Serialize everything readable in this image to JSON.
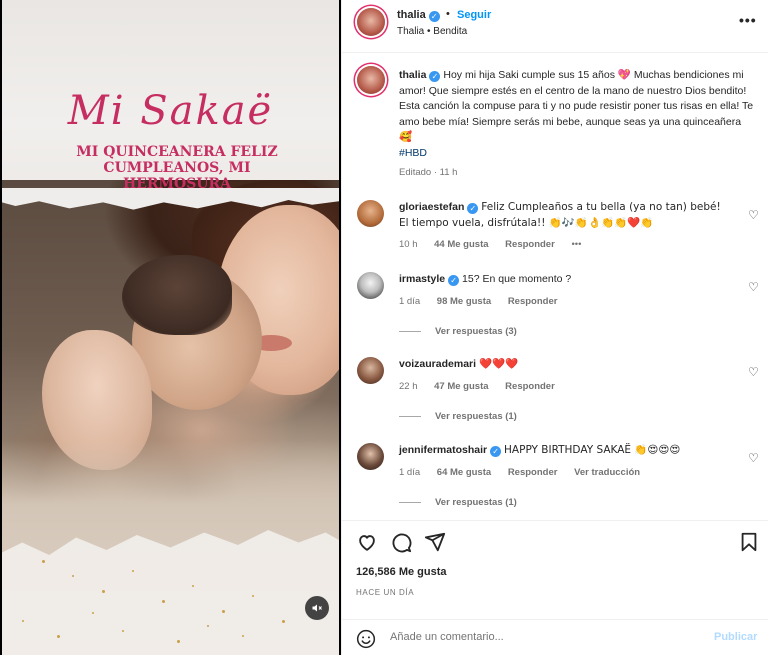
{
  "media": {
    "title": "Mi Sakaë",
    "subtitle": "MI QUINCEANERA FELIZ CUMPLEANOS, MI HERMOSURA",
    "mute_icon": "speaker-muted-icon"
  },
  "header": {
    "username": "thalia",
    "follow_label": "Seguir",
    "subtitle": "Thalia • Bendita",
    "more_icon": "more-horizontal-icon"
  },
  "caption": {
    "username": "thalia",
    "text": "Hoy mi hija Saki cumple sus 15 años 💖 Muchas bendiciones mi amor! Que siempre estés en el centro de la mano de nuestro Dios bendito! Esta canción la compuse para ti y no pude resistir poner tus risas en ella! Te amo bebe mía! Siempre serás mi bebe, aunque seas ya una quinceañera 🥰",
    "hashtag": "#HBD",
    "meta": "Editado · 11 h"
  },
  "comments": [
    {
      "username": "gloriaestefan",
      "verified": true,
      "text": "Feliz Cumpleaños a tu bella (ya no tan) bebé! El tiempo vuela, disfrútala!! 👏🎶👏👌👏👏❤️👏",
      "time": "10 h",
      "likes": "44 Me gusta",
      "reply": "Responder",
      "more": "•••"
    },
    {
      "username": "irmastyle",
      "verified": true,
      "text": "15? En que momento ?",
      "time": "1 día",
      "likes": "98 Me gusta",
      "reply": "Responder",
      "view_replies": "Ver respuestas (3)"
    },
    {
      "username": "voizaurademari",
      "verified": false,
      "text": "❤️❤️❤️",
      "time": "22 h",
      "likes": "47 Me gusta",
      "reply": "Responder",
      "view_replies": "Ver respuestas (1)"
    },
    {
      "username": "jennifermatoshair",
      "verified": true,
      "text": "HAPPY BIRTHDAY SAKAË 👏😍😍😍",
      "time": "1 día",
      "likes": "64 Me gusta",
      "reply": "Responder",
      "translate": "Ver traducción",
      "view_replies": "Ver respuestas (1)"
    }
  ],
  "actions": {
    "like_icon": "heart-icon",
    "comment_icon": "comment-icon",
    "share_icon": "share-icon",
    "save_icon": "bookmark-icon",
    "likes_count": "126,586 Me gusta",
    "date": "HACE UN DÍA"
  },
  "add_comment": {
    "placeholder": "Añade un comentario...",
    "publish_label": "Publicar",
    "emoji_icon": "smiley-icon"
  },
  "colors": {
    "accent": "#0095f6",
    "verified": "#3897f0",
    "title_pink": "#c62e62",
    "muted_text": "#737373"
  }
}
